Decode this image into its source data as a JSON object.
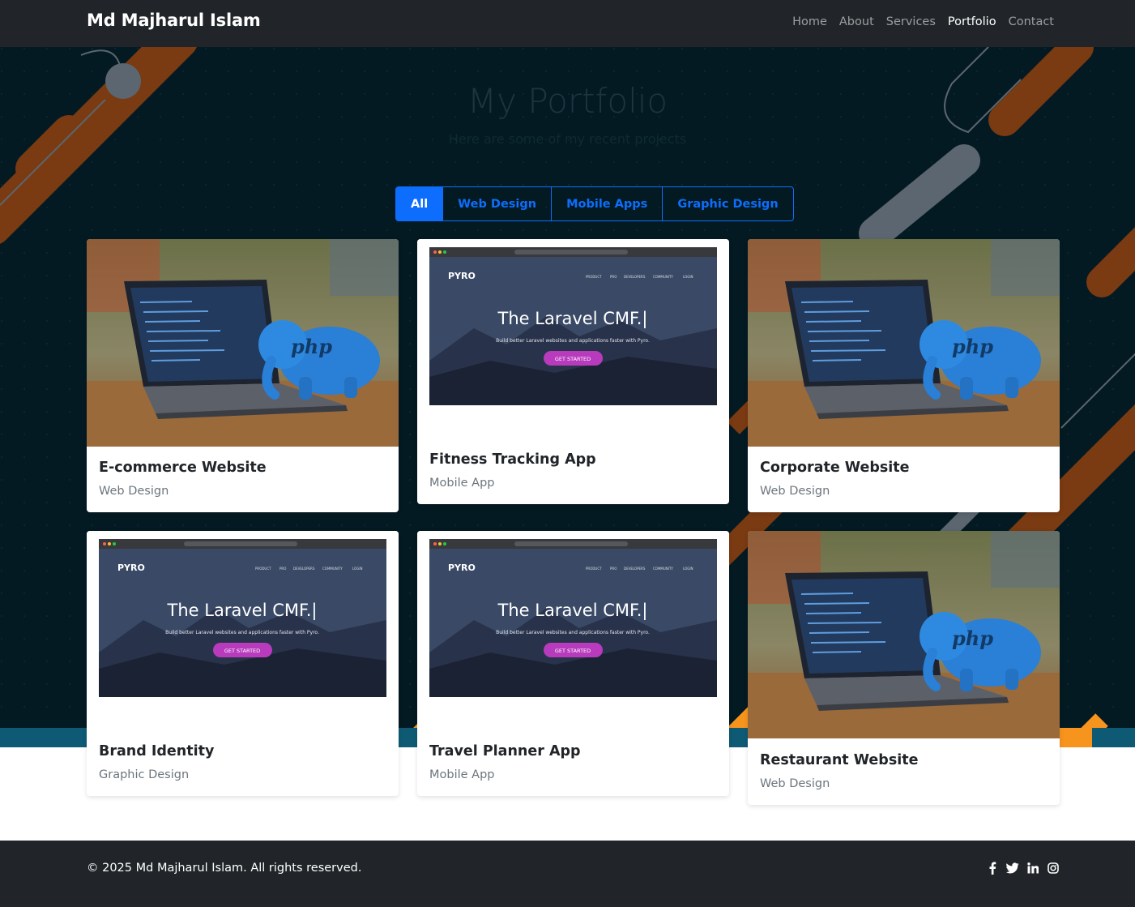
{
  "nav": {
    "brand": "Md Majharul Islam",
    "links": [
      "Home",
      "About",
      "Services",
      "Portfolio",
      "Contact"
    ],
    "active": "Portfolio"
  },
  "hero": {
    "title": "My Portfolio",
    "subtitle": "Here are some of my recent projects"
  },
  "filters": {
    "items": [
      "All",
      "Web Design",
      "Mobile Apps",
      "Graphic Design"
    ],
    "active": "All"
  },
  "projects": [
    {
      "title": "E-commerce Website",
      "category": "Web Design",
      "image": "laptop-php-elephant-photo"
    },
    {
      "title": "Fitness Tracking App",
      "category": "Mobile App",
      "image": "pyro-laravel-cmf-screenshot"
    },
    {
      "title": "Corporate Website",
      "category": "Web Design",
      "image": "laptop-php-elephant-photo"
    },
    {
      "title": "Brand Identity",
      "category": "Graphic Design",
      "image": "pyro-laravel-cmf-screenshot"
    },
    {
      "title": "Travel Planner App",
      "category": "Mobile App",
      "image": "pyro-laravel-cmf-screenshot"
    },
    {
      "title": "Restaurant Website",
      "category": "Web Design",
      "image": "laptop-php-elephant-photo"
    }
  ],
  "mockup": {
    "logo": "PYRO",
    "menu": [
      "PRODUCT",
      "PRO",
      "DEVELOPERS",
      "COMMUNITY",
      "LOGIN"
    ],
    "headline": "The Laravel CMF.|",
    "tagline": "Build better Laravel websites and applications faster with Pyro.",
    "cta": "GET STARTED"
  },
  "photo_text": "php",
  "footer": {
    "copyright": "© 2025 Md Majharul Islam. All rights reserved.",
    "socials": [
      "facebook-icon",
      "twitter-icon",
      "linkedin-icon",
      "instagram-icon"
    ]
  },
  "colors": {
    "navbar": "#212529",
    "hero_bg": "#041a22",
    "accent": "#0d6efd",
    "stripe_brown": "#7a3a12",
    "stripe_orange": "#f7941d",
    "stripe_teal": "#0e5a74"
  }
}
